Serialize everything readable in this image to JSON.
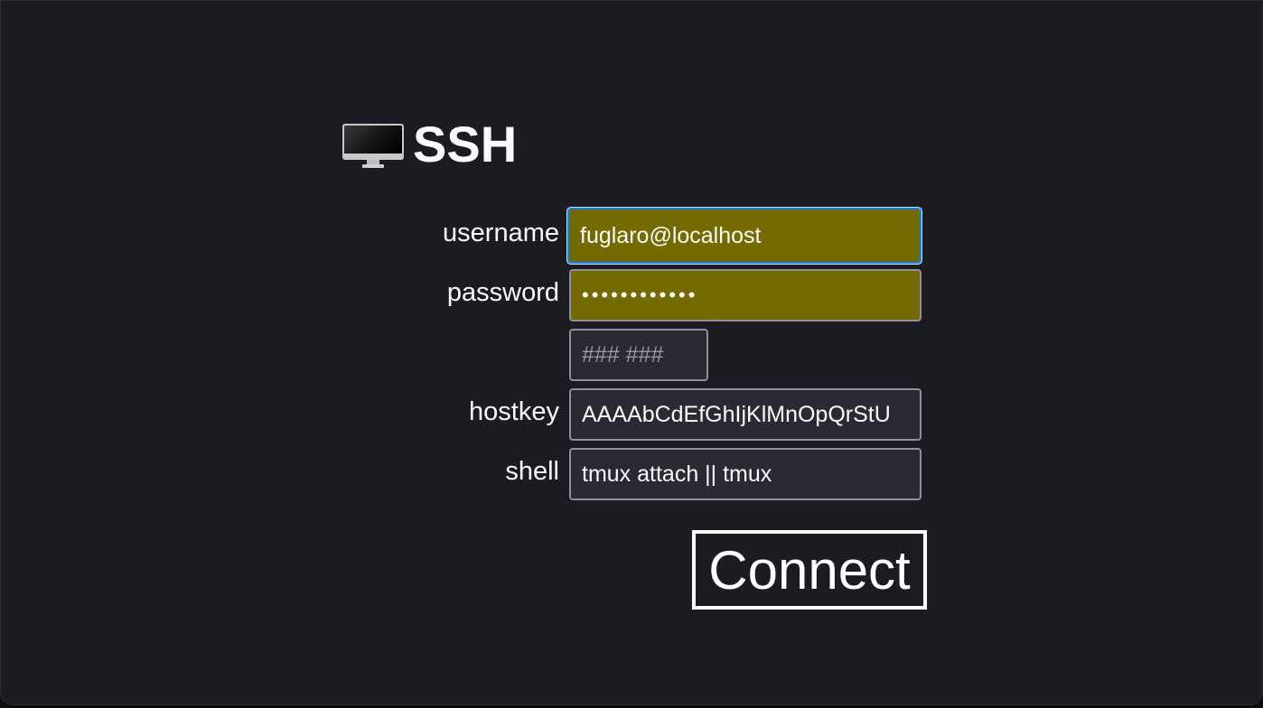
{
  "header": {
    "icon": "desktop-computer-icon",
    "title": "SSH"
  },
  "form": {
    "username": {
      "label": "username",
      "value": "fuglaro@localhost",
      "autofilled": true,
      "focused": true
    },
    "password": {
      "label": "password",
      "value": "••••••••••••",
      "autofilled": true
    },
    "otp": {
      "label": "",
      "placeholder": "### ###"
    },
    "hostkey": {
      "label": "hostkey",
      "value": "AAAAbCdEfGhIjKlMnOpQrStU"
    },
    "shell": {
      "label": "shell",
      "value": "tmux attach || tmux"
    },
    "submit_label": "Connect"
  },
  "colors": {
    "background": "#1c1b22",
    "field_background": "#2b2a33",
    "autofill_background": "#736b00",
    "focus_ring": "#0a84ff",
    "text": "#fbfbfe"
  }
}
